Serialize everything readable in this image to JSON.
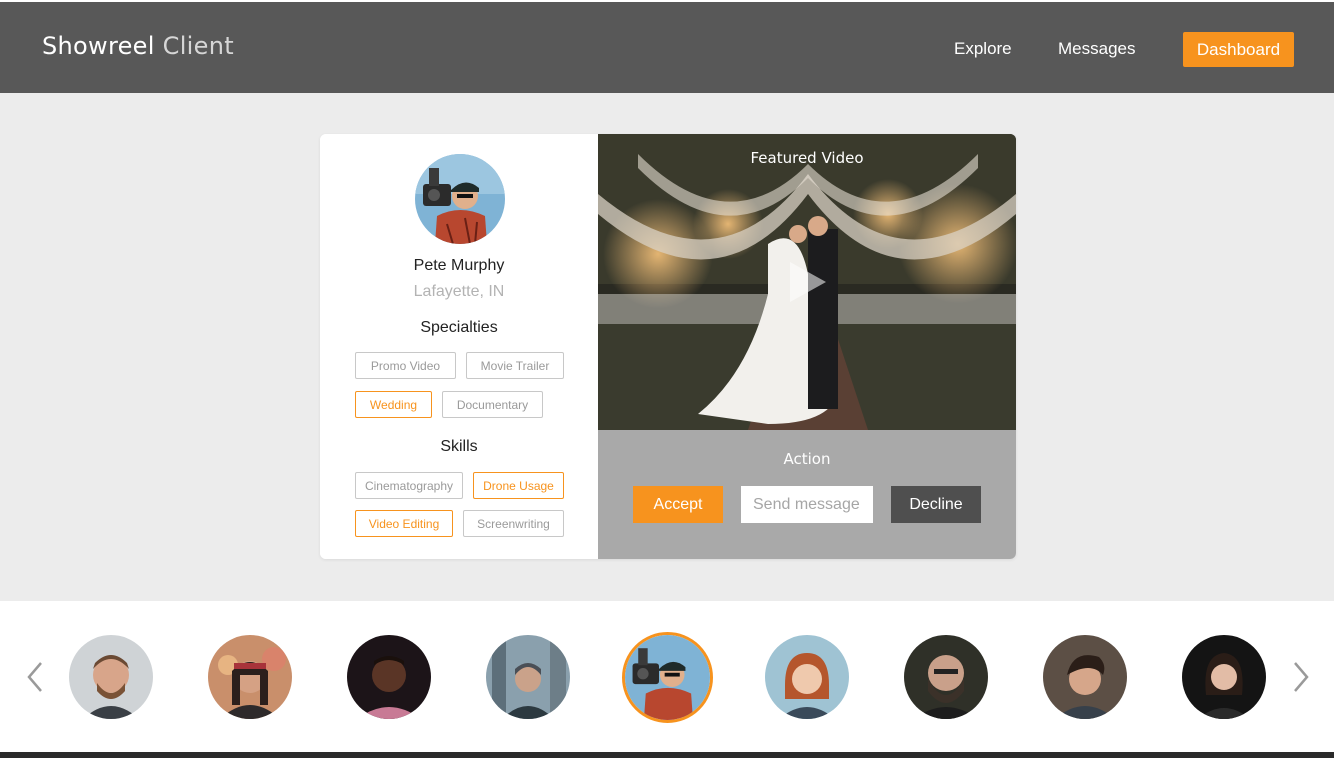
{
  "header": {
    "brand_bold": "Showreel",
    "brand_light": "Client",
    "nav": {
      "explore": "Explore",
      "messages": "Messages",
      "dashboard": "Dashboard"
    }
  },
  "profile": {
    "name": "Pete Murphy",
    "location": "Lafayette, IN",
    "specialties_title": "Specialties",
    "specialties": [
      {
        "label": "Promo Video",
        "active": false
      },
      {
        "label": "Movie Trailer",
        "active": false
      },
      {
        "label": "Wedding",
        "active": true
      },
      {
        "label": "Documentary",
        "active": false
      }
    ],
    "skills_title": "Skills",
    "skills": [
      {
        "label": "Cinematography",
        "active": false
      },
      {
        "label": "Drone Usage",
        "active": true
      },
      {
        "label": "Video Editing",
        "active": true
      },
      {
        "label": "Screenwriting",
        "active": false
      }
    ]
  },
  "video": {
    "title": "Featured Video"
  },
  "action": {
    "title": "Action",
    "accept_label": "Accept",
    "message_placeholder": "Send message",
    "decline_label": "Decline"
  },
  "carousel": {
    "selected_index": 4,
    "count": 9
  },
  "colors": {
    "accent": "#f7931e",
    "header_bg": "#585858",
    "action_bg": "#a9a9a9",
    "decline_bg": "#4f4f4f"
  }
}
